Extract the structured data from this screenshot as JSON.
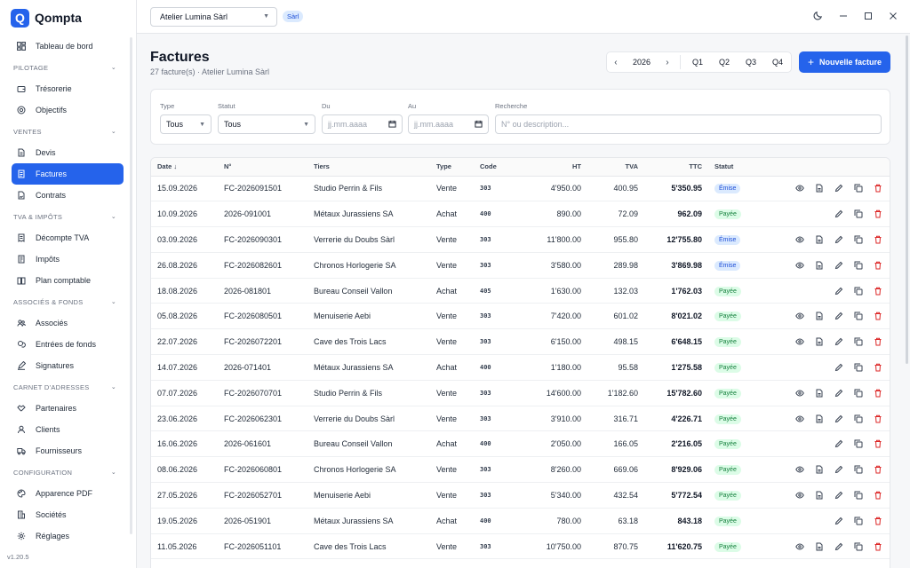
{
  "app": {
    "logo_letter": "Q",
    "name": "Qompta",
    "version": "v1.20.5"
  },
  "sidebar": {
    "dashboard": "Tableau de bord",
    "sections": [
      {
        "title": "Pilotage",
        "items": [
          {
            "label": "Trésorerie",
            "icon": "wallet-icon"
          },
          {
            "label": "Objectifs",
            "icon": "target-icon"
          }
        ]
      },
      {
        "title": "Ventes",
        "items": [
          {
            "label": "Devis",
            "icon": "document-icon"
          },
          {
            "label": "Factures",
            "icon": "invoice-icon",
            "active": true
          },
          {
            "label": "Contrats",
            "icon": "contract-icon"
          }
        ]
      },
      {
        "title": "TVA & impôts",
        "items": [
          {
            "label": "Décompte TVA",
            "icon": "receipt-icon"
          },
          {
            "label": "Impôts",
            "icon": "tax-icon"
          },
          {
            "label": "Plan comptable",
            "icon": "book-icon"
          }
        ]
      },
      {
        "title": "Associés & fonds",
        "items": [
          {
            "label": "Associés",
            "icon": "users-icon"
          },
          {
            "label": "Entrées de fonds",
            "icon": "coins-icon"
          },
          {
            "label": "Signatures",
            "icon": "pen-icon"
          }
        ]
      },
      {
        "title": "Carnet d'adresses",
        "items": [
          {
            "label": "Partenaires",
            "icon": "handshake-icon"
          },
          {
            "label": "Clients",
            "icon": "user-icon"
          },
          {
            "label": "Fournisseurs",
            "icon": "truck-icon"
          }
        ]
      },
      {
        "title": "Configuration",
        "items": [
          {
            "label": "Apparence PDF",
            "icon": "palette-icon"
          },
          {
            "label": "Sociétés",
            "icon": "building-icon"
          },
          {
            "label": "Réglages",
            "icon": "gear-icon"
          }
        ]
      }
    ]
  },
  "topbar": {
    "company": "Atelier Lumina Sàrl",
    "company_badge": "Sàrl"
  },
  "page": {
    "title": "Factures",
    "subtitle": "27 facture(s) · Atelier Lumina Sàrl",
    "year": "2026",
    "quarters": [
      "Q1",
      "Q2",
      "Q3",
      "Q4"
    ],
    "new_button": "Nouvelle facture"
  },
  "filters": {
    "type_label": "Type",
    "type_value": "Tous",
    "status_label": "Statut",
    "status_value": "Tous",
    "from_label": "Du",
    "from_placeholder": "jj.mm.aaaa",
    "to_label": "Au",
    "to_placeholder": "jj.mm.aaaa",
    "search_label": "Recherche",
    "search_placeholder": "N° ou description..."
  },
  "table": {
    "headers": {
      "date": "Date ↓",
      "number": "N°",
      "party": "Tiers",
      "type": "Type",
      "code": "Code",
      "ht": "HT",
      "tva": "TVA",
      "ttc": "TTC",
      "status": "Statut"
    },
    "rows": [
      {
        "date": "15.09.2026",
        "number": "FC-2026091501",
        "party": "Studio Perrin & Fils",
        "type": "Vente",
        "code": "303",
        "ht": "4'950.00",
        "tva": "400.95",
        "ttc": "5'350.95",
        "status": "Émise"
      },
      {
        "date": "10.09.2026",
        "number": "2026-091001",
        "party": "Métaux Jurassiens SA",
        "type": "Achat",
        "code": "400",
        "ht": "890.00",
        "tva": "72.09",
        "ttc": "962.09",
        "status": "Payée"
      },
      {
        "date": "03.09.2026",
        "number": "FC-2026090301",
        "party": "Verrerie du Doubs Sàrl",
        "type": "Vente",
        "code": "303",
        "ht": "11'800.00",
        "tva": "955.80",
        "ttc": "12'755.80",
        "status": "Émise"
      },
      {
        "date": "26.08.2026",
        "number": "FC-2026082601",
        "party": "Chronos Horlogerie SA",
        "type": "Vente",
        "code": "303",
        "ht": "3'580.00",
        "tva": "289.98",
        "ttc": "3'869.98",
        "status": "Émise"
      },
      {
        "date": "18.08.2026",
        "number": "2026-081801",
        "party": "Bureau Conseil Vallon",
        "type": "Achat",
        "code": "405",
        "ht": "1'630.00",
        "tva": "132.03",
        "ttc": "1'762.03",
        "status": "Payée"
      },
      {
        "date": "05.08.2026",
        "number": "FC-2026080501",
        "party": "Menuiserie Aebi",
        "type": "Vente",
        "code": "303",
        "ht": "7'420.00",
        "tva": "601.02",
        "ttc": "8'021.02",
        "status": "Payée"
      },
      {
        "date": "22.07.2026",
        "number": "FC-2026072201",
        "party": "Cave des Trois Lacs",
        "type": "Vente",
        "code": "303",
        "ht": "6'150.00",
        "tva": "498.15",
        "ttc": "6'648.15",
        "status": "Payée"
      },
      {
        "date": "14.07.2026",
        "number": "2026-071401",
        "party": "Métaux Jurassiens SA",
        "type": "Achat",
        "code": "400",
        "ht": "1'180.00",
        "tva": "95.58",
        "ttc": "1'275.58",
        "status": "Payée"
      },
      {
        "date": "07.07.2026",
        "number": "FC-2026070701",
        "party": "Studio Perrin & Fils",
        "type": "Vente",
        "code": "303",
        "ht": "14'600.00",
        "tva": "1'182.60",
        "ttc": "15'782.60",
        "status": "Payée"
      },
      {
        "date": "23.06.2026",
        "number": "FC-2026062301",
        "party": "Verrerie du Doubs Sàrl",
        "type": "Vente",
        "code": "303",
        "ht": "3'910.00",
        "tva": "316.71",
        "ttc": "4'226.71",
        "status": "Payée"
      },
      {
        "date": "16.06.2026",
        "number": "2026-061601",
        "party": "Bureau Conseil Vallon",
        "type": "Achat",
        "code": "400",
        "ht": "2'050.00",
        "tva": "166.05",
        "ttc": "2'216.05",
        "status": "Payée"
      },
      {
        "date": "08.06.2026",
        "number": "FC-2026060801",
        "party": "Chronos Horlogerie SA",
        "type": "Vente",
        "code": "303",
        "ht": "8'260.00",
        "tva": "669.06",
        "ttc": "8'929.06",
        "status": "Payée"
      },
      {
        "date": "27.05.2026",
        "number": "FC-2026052701",
        "party": "Menuiserie Aebi",
        "type": "Vente",
        "code": "303",
        "ht": "5'340.00",
        "tva": "432.54",
        "ttc": "5'772.54",
        "status": "Payée"
      },
      {
        "date": "19.05.2026",
        "number": "2026-051901",
        "party": "Métaux Jurassiens SA",
        "type": "Achat",
        "code": "400",
        "ht": "780.00",
        "tva": "63.18",
        "ttc": "843.18",
        "status": "Payée"
      },
      {
        "date": "11.05.2026",
        "number": "FC-2026051101",
        "party": "Cave des Trois Lacs",
        "type": "Vente",
        "code": "303",
        "ht": "10'750.00",
        "tva": "870.75",
        "ttc": "11'620.75",
        "status": "Payée"
      }
    ]
  },
  "colors": {
    "accent": "#2563eb",
    "danger": "#dc2626",
    "status_emise_bg": "#dbeafe",
    "status_payee_bg": "#dcfce7"
  }
}
